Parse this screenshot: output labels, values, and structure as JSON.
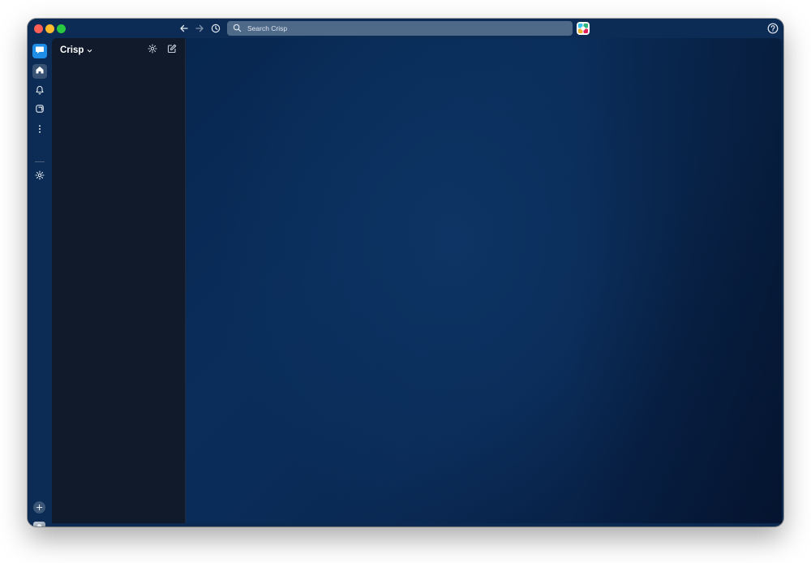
{
  "window": {
    "title_bar": {
      "search_placeholder": "Search Crisp"
    }
  },
  "workspace": {
    "name": "Crisp"
  },
  "icons": {
    "back": "arrow-left-icon",
    "forward": "arrow-right-icon",
    "history": "clock-icon",
    "search": "search-icon",
    "app_logo": "app-logo-icon",
    "help": "help-icon",
    "workspace": "workspace-icon",
    "home": "home-icon",
    "activity": "bell-icon",
    "later": "bookmark-icon",
    "more": "more-vertical-icon",
    "settings": "gear-icon",
    "add_workspace": "plus-icon",
    "compose": "compose-icon",
    "chevron": "chevron-down-icon"
  },
  "colors": {
    "window_bg": "#0c2c55",
    "sidebar_bg": "#111a2b",
    "workspace_accent": "#1e8ee6",
    "search_bg": "#4f6988"
  }
}
